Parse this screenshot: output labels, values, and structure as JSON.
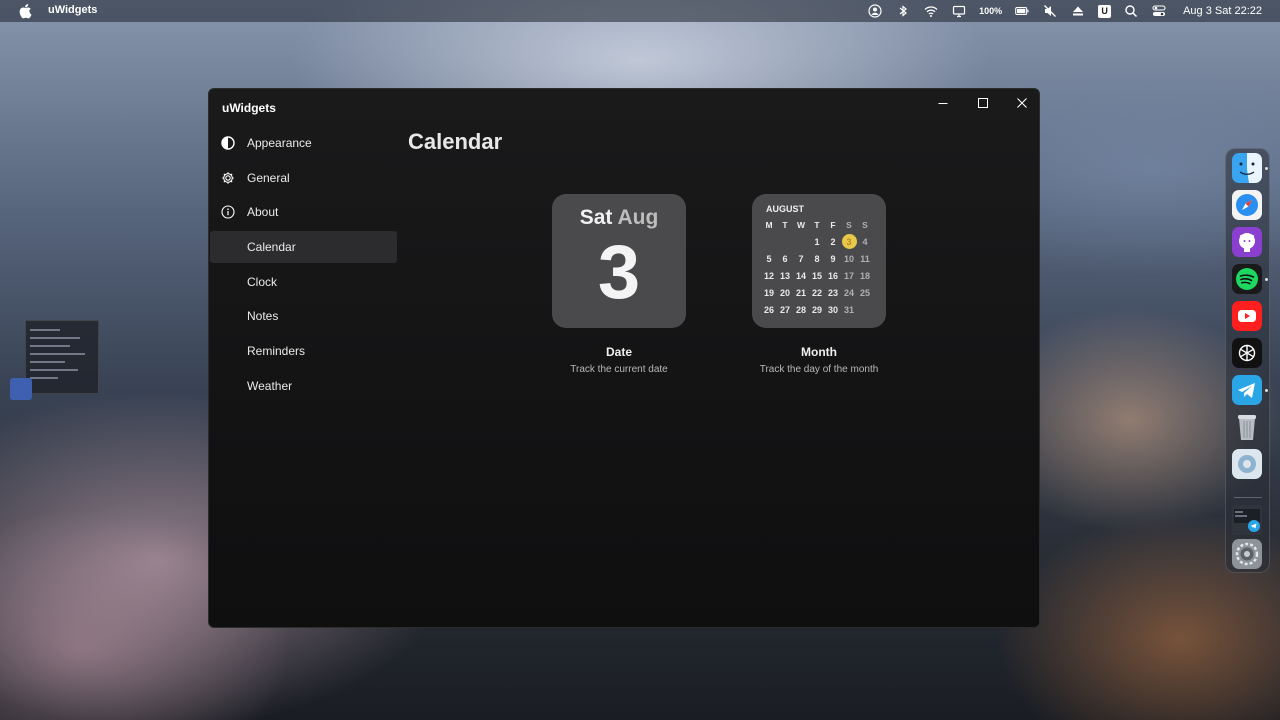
{
  "menubar": {
    "app_name": "uWidgets",
    "battery": "100%",
    "u_badge": "U",
    "clock": "Aug 3 Sat 22:22",
    "icons": [
      "apple-icon",
      "user-icon",
      "bluetooth-icon",
      "wifi-icon",
      "display-icon",
      "battery-icon",
      "mute-icon",
      "eject-icon",
      "search-icon",
      "control-center-icon"
    ]
  },
  "window": {
    "title": "uWidgets",
    "controls": [
      "minimize-icon",
      "maximize-icon",
      "close-icon"
    ],
    "nav": [
      {
        "label": "Appearance",
        "icon": "appearance-icon"
      },
      {
        "label": "General",
        "icon": "gear-icon"
      },
      {
        "label": "About",
        "icon": "info-icon"
      },
      {
        "label": "Calendar",
        "active": true
      },
      {
        "label": "Clock"
      },
      {
        "label": "Notes"
      },
      {
        "label": "Reminders"
      },
      {
        "label": "Weather"
      }
    ],
    "page_title": "Calendar"
  },
  "widgets": {
    "date": {
      "weekday": "Sat",
      "month": "Aug",
      "day": "3",
      "label": "Date",
      "description": "Track the current date"
    },
    "month": {
      "month_name": "AUGUST",
      "weekday_headers": [
        "M",
        "T",
        "W",
        "T",
        "F",
        "S",
        "S"
      ],
      "weeks": [
        [
          "",
          "",
          "",
          "1",
          "2",
          "3",
          "4"
        ],
        [
          "5",
          "6",
          "7",
          "8",
          "9",
          "10",
          "11"
        ],
        [
          "12",
          "13",
          "14",
          "15",
          "16",
          "17",
          "18"
        ],
        [
          "19",
          "20",
          "21",
          "22",
          "23",
          "24",
          "25"
        ],
        [
          "26",
          "27",
          "28",
          "29",
          "30",
          "31",
          ""
        ]
      ],
      "today": "3",
      "today_color": "#e8c84a",
      "label": "Month",
      "description": "Track the day of the month"
    }
  },
  "dock": {
    "apps": [
      "finder-icon",
      "safari-icon",
      "github-icon",
      "spotify-icon",
      "youtube-icon",
      "chatgpt-icon",
      "telegram-icon",
      "trash-icon",
      "app-icon",
      "telegram-window-thumbnail",
      "system-settings-icon"
    ]
  },
  "colors": {
    "window_bg": "#141415",
    "active_nav": "#2c2c2e",
    "widget_bg": "#4a4a4c",
    "today_highlight": "#e8c84a"
  }
}
